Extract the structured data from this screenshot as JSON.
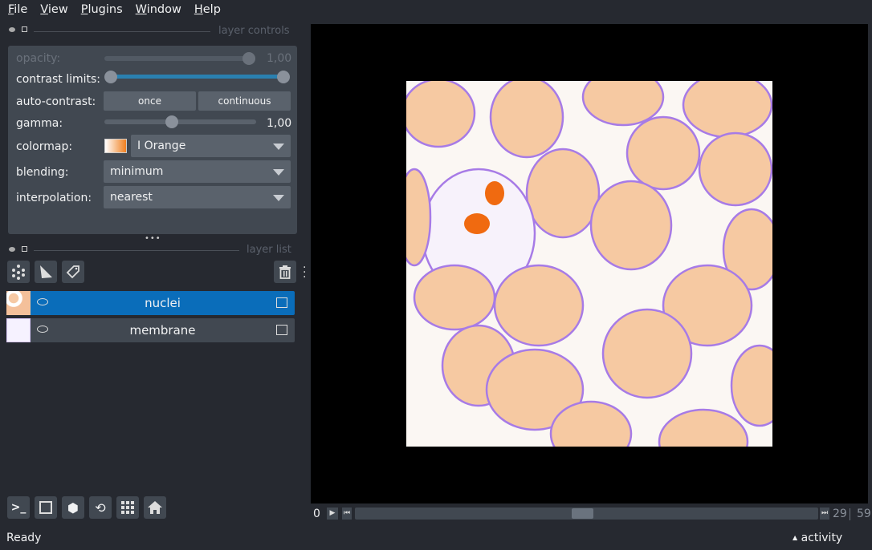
{
  "menu": [
    "File",
    "View",
    "Plugins",
    "Window",
    "Help"
  ],
  "layer_controls": {
    "title": "layer controls",
    "opacity_label": "opacity:",
    "opacity_value": "1,00",
    "opacity": 1.0,
    "contrast_label": "contrast limits:",
    "contrast_range": [
      0,
      1
    ],
    "auto_contrast_label": "auto-contrast:",
    "once": "once",
    "continuous": "continuous",
    "gamma_label": "gamma:",
    "gamma_value": "1,00",
    "gamma": 1.0,
    "colormap_label": "colormap:",
    "colormap": "I Orange",
    "blending_label": "blending:",
    "blending": "minimum",
    "interpolation_label": "interpolation:",
    "interpolation": "nearest"
  },
  "layer_list": {
    "title": "layer list",
    "layers": [
      {
        "name": "nuclei",
        "selected": true
      },
      {
        "name": "membrane",
        "selected": false
      }
    ]
  },
  "dims": {
    "current": "0",
    "slider_value": 29,
    "max": "59",
    "current_label": "29",
    "max_label": "59"
  },
  "status": {
    "text": "Ready",
    "activity": "activity"
  },
  "colors": {
    "selected": "#0a6dba",
    "orange": "#f08a40",
    "purple": "#8a4fe0"
  }
}
